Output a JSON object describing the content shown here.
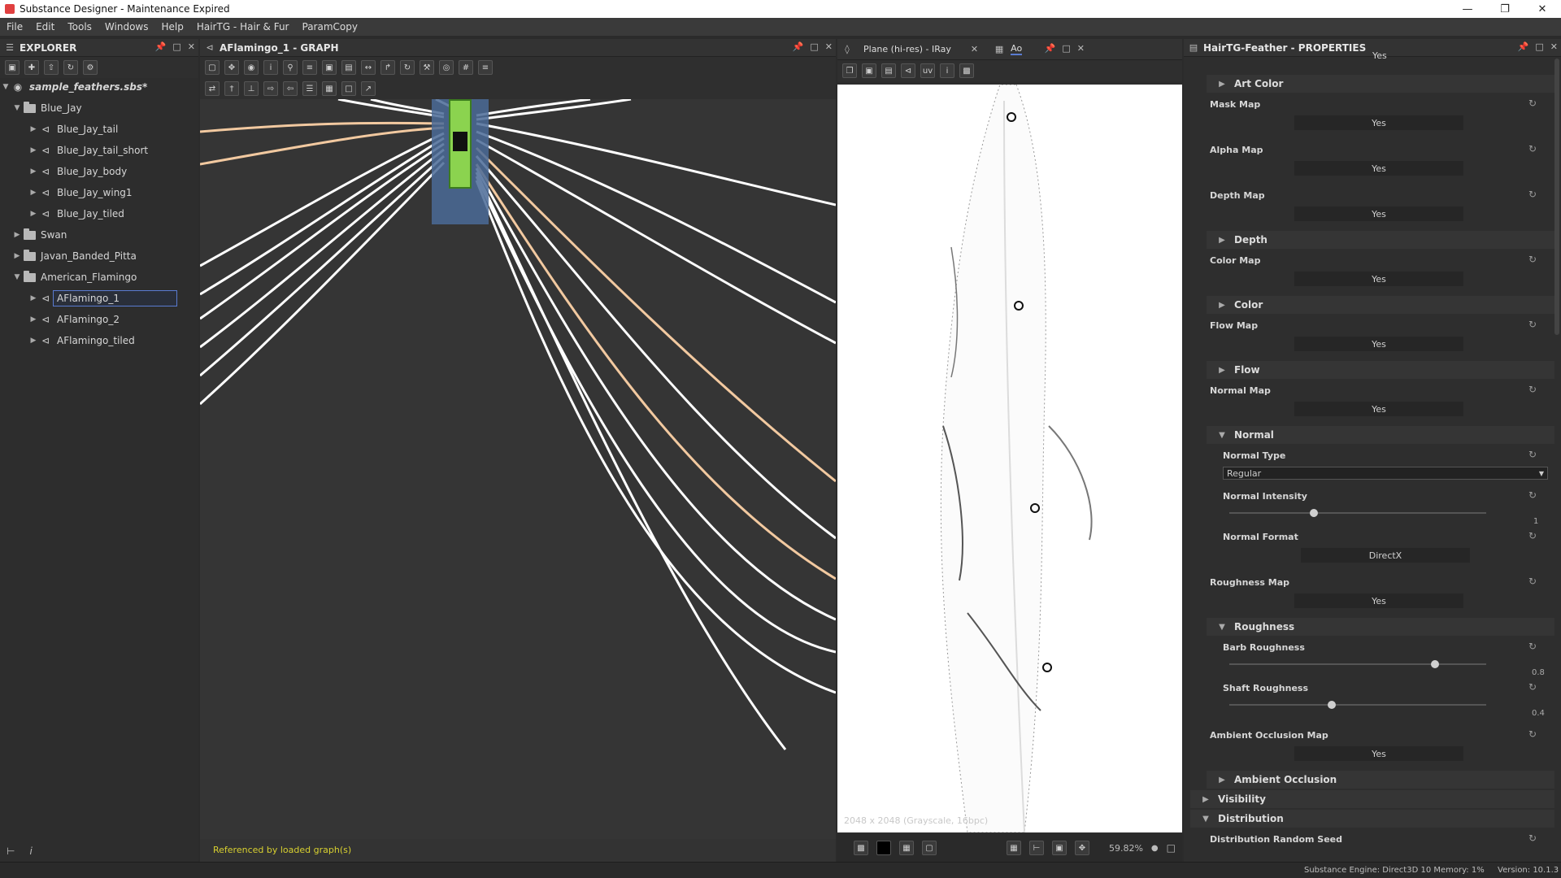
{
  "window": {
    "title": "Substance Designer - Maintenance Expired"
  },
  "menu": [
    "File",
    "Edit",
    "Tools",
    "Windows",
    "Help",
    "HairTG - Hair & Fur",
    "ParamCopy"
  ],
  "explorer": {
    "title": "EXPLORER",
    "package": "sample_feathers.sbs*",
    "items": [
      {
        "label": "Blue_Jay",
        "type": "folder",
        "level": 1,
        "expanded": true
      },
      {
        "label": "Blue_Jay_tail",
        "type": "graph",
        "level": 2
      },
      {
        "label": "Blue_Jay_tail_short",
        "type": "graph",
        "level": 2
      },
      {
        "label": "Blue_Jay_body",
        "type": "graph",
        "level": 2
      },
      {
        "label": "Blue_Jay_wing1",
        "type": "graph",
        "level": 2
      },
      {
        "label": "Blue_Jay_tiled",
        "type": "graph",
        "level": 2
      },
      {
        "label": "Swan",
        "type": "folder",
        "level": 1,
        "expanded": false
      },
      {
        "label": "Javan_Banded_Pitta",
        "type": "folder",
        "level": 1,
        "expanded": false
      },
      {
        "label": "American_Flamingo",
        "type": "folder",
        "level": 1,
        "expanded": true
      },
      {
        "label": "AFlamingo_1",
        "type": "graph",
        "level": 2,
        "selected": true
      },
      {
        "label": "AFlamingo_2",
        "type": "graph",
        "level": 2
      },
      {
        "label": "AFlamingo_tiled",
        "type": "graph",
        "level": 2
      }
    ]
  },
  "graph": {
    "title": "AFlamingo_1 - GRAPH",
    "status": "Referenced by loaded graph(s)"
  },
  "viewer": {
    "tab": "Plane (hi-res) - IRay",
    "tab2": "Ao",
    "info": "2048 x 2048 (Grayscale, 16bpc)",
    "zoom": "59.82%"
  },
  "properties": {
    "title": "HairTG-Feather - PROPERTIES",
    "top_value": "Yes",
    "sections": {
      "art_color": "Art Color",
      "depth": "Depth",
      "color": "Color",
      "flow": "Flow",
      "normal": "Normal",
      "roughness": "Roughness",
      "ambient_occlusion": "Ambient Occlusion",
      "visibility": "Visibility",
      "distribution": "Distribution"
    },
    "mask_map": {
      "label": "Mask Map",
      "value": "Yes"
    },
    "alpha_map": {
      "label": "Alpha Map",
      "value": "Yes"
    },
    "depth_map": {
      "label": "Depth Map",
      "value": "Yes"
    },
    "color_map": {
      "label": "Color Map",
      "value": "Yes"
    },
    "flow_map": {
      "label": "Flow Map",
      "value": "Yes"
    },
    "normal_map": {
      "label": "Normal Map",
      "value": "Yes"
    },
    "normal_type": {
      "label": "Normal Type",
      "value": "Regular"
    },
    "normal_intensity": {
      "label": "Normal Intensity",
      "value": "1",
      "fraction": 0.33
    },
    "normal_format": {
      "label": "Normal Format",
      "value": "DirectX"
    },
    "roughness_map": {
      "label": "Roughness Map",
      "value": "Yes"
    },
    "barb_roughness": {
      "label": "Barb Roughness",
      "value": "0.8",
      "fraction": 0.8
    },
    "shaft_roughness": {
      "label": "Shaft Roughness",
      "value": "0.4",
      "fraction": 0.4
    },
    "ao_map": {
      "label": "Ambient Occlusion Map",
      "value": "Yes"
    },
    "dist_seed": {
      "label": "Distribution Random Seed"
    }
  },
  "status": {
    "engine": "Substance Engine: Direct3D 10  Memory: 1%",
    "version": "Version: 10.1.3"
  }
}
